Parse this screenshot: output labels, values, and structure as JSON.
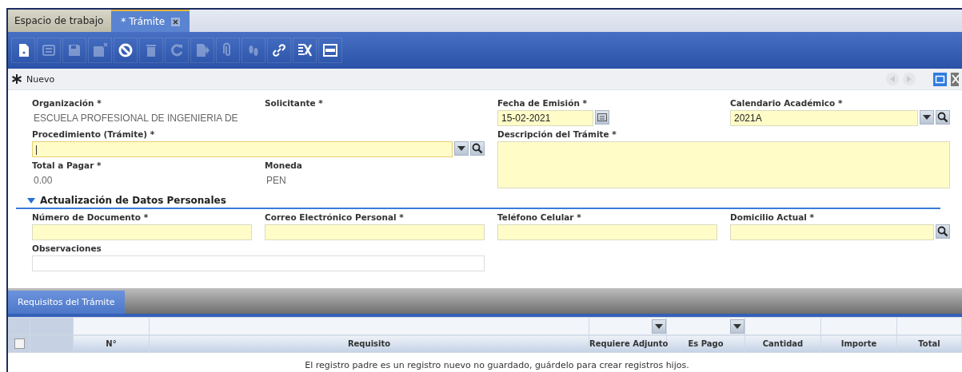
{
  "tabs": [
    {
      "label": "Espacio de trabajo",
      "selected": false,
      "closable": false
    },
    {
      "label": "* Trámite",
      "selected": true,
      "closable": true
    }
  ],
  "toolbar": [
    {
      "kind": "new",
      "disabled": false
    },
    {
      "kind": "list",
      "disabled": true
    },
    {
      "kind": "save",
      "disabled": true
    },
    {
      "kind": "save-close",
      "disabled": true
    },
    {
      "kind": "ignore",
      "disabled": false
    },
    {
      "kind": "delete",
      "disabled": true
    },
    {
      "kind": "refresh",
      "disabled": true
    },
    {
      "kind": "export",
      "disabled": true
    },
    {
      "kind": "attach",
      "disabled": true
    },
    {
      "kind": "steps",
      "disabled": true
    },
    {
      "kind": "link",
      "disabled": false
    },
    {
      "kind": "tools",
      "disabled": false
    },
    {
      "kind": "toggle",
      "disabled": false
    }
  ],
  "record_bar": {
    "title": "Nuevo",
    "prev_disabled": true,
    "next_disabled": true
  },
  "form": {
    "fields": [
      {
        "label": "Organización *",
        "kind": "readonly",
        "value": "ESCUELA PROFESIONAL DE INGENIERIA DE"
      },
      {
        "label": "Solicitante *",
        "kind": "readonly"
      },
      {
        "label": "Fecha de Emisión *",
        "kind": "date",
        "value": "15-02-2021"
      },
      {
        "label": "Calendario Académico *",
        "kind": "select-lookup",
        "value": "2021A"
      },
      {
        "label": "Procedimiento (Trámite) *",
        "kind": "select-lookup",
        "focused": true
      },
      {
        "label": "Descripción del Trámite *",
        "kind": "textarea"
      },
      {
        "label": "Total a Pagar *",
        "kind": "readonly",
        "value": "0.00"
      },
      {
        "label": "Moneda",
        "kind": "readonly",
        "value": "PEN"
      }
    ],
    "section": {
      "title": "Actualización de Datos Personales",
      "expanded": true,
      "fields": [
        {
          "label": "Número de Documento *",
          "kind": "text"
        },
        {
          "label": "Correo Electrónico Personal *",
          "kind": "text"
        },
        {
          "label": "Teléfono Celular *",
          "kind": "text"
        },
        {
          "label": "Domicilio Actual *",
          "kind": "lookup"
        },
        {
          "label": "Observaciones",
          "kind": "plain"
        }
      ]
    }
  },
  "detail": {
    "tab": "Requisitos del Trámite",
    "columns": [
      {
        "kind": "check"
      },
      {
        "kind": "blank"
      },
      {
        "label": "N°",
        "kind": "text"
      },
      {
        "label": "Requisito",
        "kind": "text"
      },
      {
        "label": "Requiere Adjunto",
        "kind": "filter"
      },
      {
        "label": "Es Pago",
        "kind": "filter"
      },
      {
        "label": "Cantidad",
        "kind": "text"
      },
      {
        "label": "Importe",
        "kind": "text"
      },
      {
        "label": "Total",
        "kind": "text"
      }
    ],
    "select_all_checked": false,
    "message": "El registro padre es un registro nuevo no guardado, guárdelo para crear registros hijos."
  }
}
